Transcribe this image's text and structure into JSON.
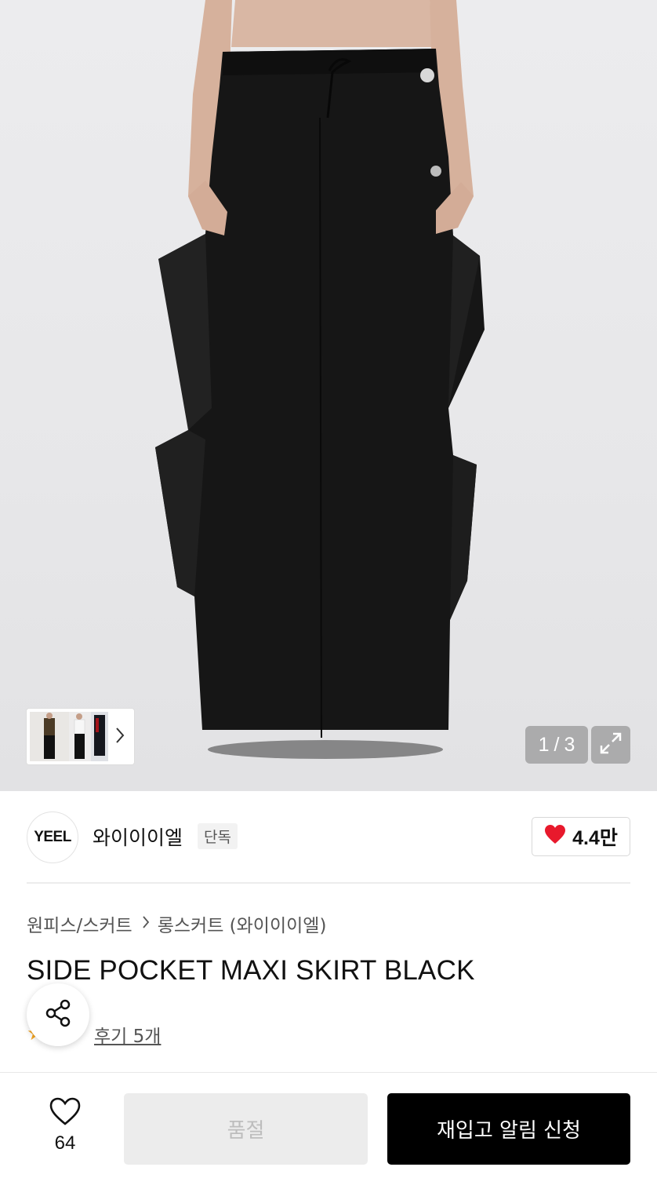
{
  "gallery": {
    "current_page": "1",
    "page_separator": "/",
    "total_pages": "3",
    "image_subject": "black side pocket maxi skirt on model"
  },
  "brand": {
    "logo_text": "YEEL",
    "name": "와이이이엘",
    "badge": "단독",
    "likes": "4.4만",
    "heart_color": "#e8192c"
  },
  "breadcrumb": {
    "category": "원피스/스커트",
    "subcategory": "롱스커트 (와이이이엘)"
  },
  "product": {
    "title": "SIDE POCKET MAXI SKIRT BLACK",
    "review_link": "후기 5개",
    "star_color": "#f5a623"
  },
  "bottom_bar": {
    "wish_count": "64",
    "soldout_label": "품절",
    "restock_label": "재입고 알림 신청"
  },
  "icons": {
    "expand": "expand-icon",
    "share": "share-icon",
    "heart_outline": "heart-outline-icon",
    "heart_filled": "heart-filled-icon",
    "chevron_right": "chevron-right-icon"
  }
}
